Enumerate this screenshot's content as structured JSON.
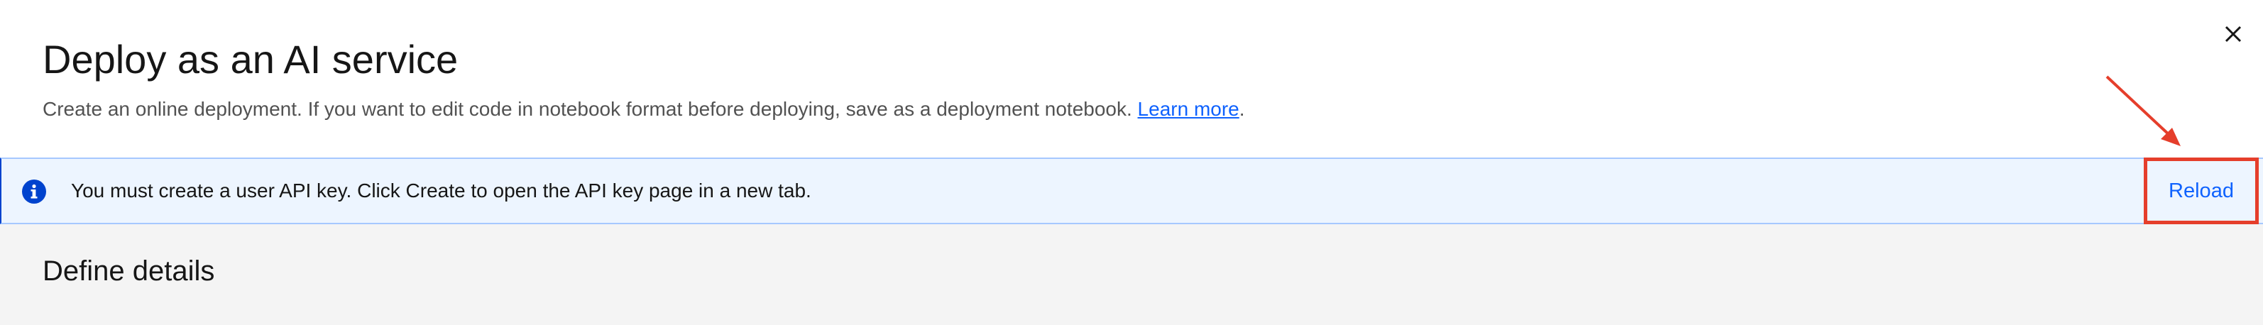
{
  "modal": {
    "title": "Deploy as an AI service",
    "description": "Create an online deployment. If you want to edit code in notebook format before deploying, save as a deployment notebook.",
    "learn_more_label": "Learn more",
    "description_suffix": ".",
    "close_icon": "close-icon"
  },
  "notification": {
    "kind": "info",
    "icon": "info-icon",
    "message": "You must create a user API key. Click Create to open the API key page in a new tab.",
    "action_label": "Reload"
  },
  "section": {
    "title": "Define details"
  },
  "colors": {
    "link": "#0f62fe",
    "info_background": "#edf5ff",
    "info_icon": "#0043ce",
    "annotation": "#e53e2b",
    "section_background": "#f4f4f4"
  }
}
